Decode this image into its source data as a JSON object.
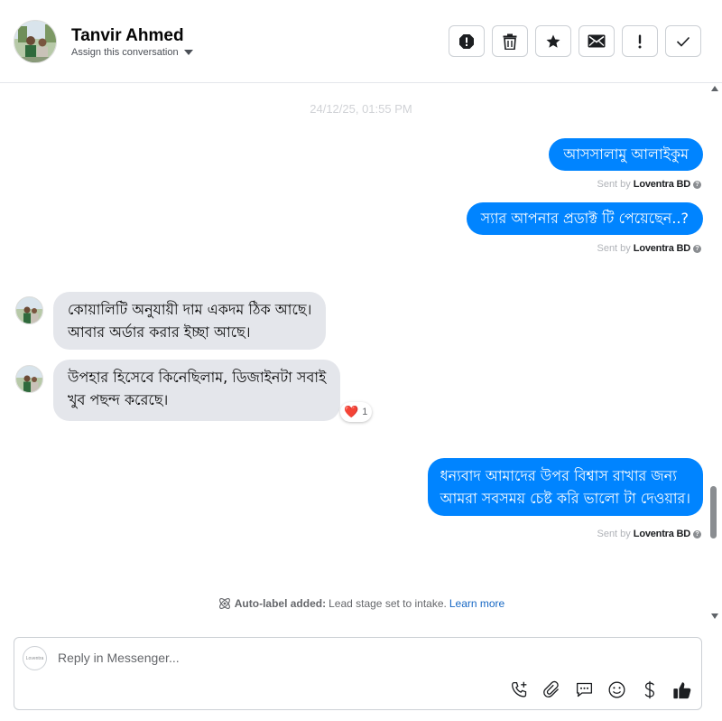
{
  "header": {
    "contact_name": "Tanvir Ahmed",
    "assign_label": "Assign this conversation",
    "actions": [
      "spam-icon",
      "trash-icon",
      "star-icon",
      "mail-icon",
      "exclamation-icon",
      "check-icon"
    ]
  },
  "conversation": {
    "timestamp": "24/12/25, 01:55 PM",
    "messages": [
      {
        "direction": "out",
        "text": "আসসালামু আলাইকুম",
        "sent_by_prefix": "Sent by",
        "sent_by_name": "Loventra BD"
      },
      {
        "direction": "out",
        "text": "স্যার আপনার প্রডাক্ট টি পেয়েছেন..?",
        "sent_by_prefix": "Sent by",
        "sent_by_name": "Loventra BD"
      },
      {
        "direction": "in",
        "lines": [
          "কোয়ালিটি অনুযায়ী দাম একদম ঠিক আছে।",
          "আবার অর্ডার করার ইচ্ছা আছে।"
        ]
      },
      {
        "direction": "in",
        "lines": [
          "উপহার হিসেবে কিনেছিলাম, ডিজাইনটা সবাই",
          "খুব পছন্দ করেছে।"
        ],
        "reaction": {
          "emoji": "❤️",
          "count": "1"
        }
      },
      {
        "direction": "out",
        "lines": [
          "ধন্যবাদ আমাদের উপর বিশ্বাস রাখার জন্য",
          "আমরা সবসময় চেষ্ট করি ভালো টা দেওয়ার।"
        ],
        "sent_by_prefix": "Sent by",
        "sent_by_name": "Loventra BD"
      }
    ],
    "auto_label": {
      "bold": "Auto-label added:",
      "text": "Lead stage set to intake.",
      "link": "Learn more"
    }
  },
  "composer": {
    "placeholder": "Reply in Messenger...",
    "page_avatar_text": "Loventra",
    "tools": [
      "call-add-icon",
      "paperclip-icon",
      "saved-reply-icon",
      "emoji-icon",
      "dollar-icon",
      "thumbs-up-icon"
    ]
  },
  "colors": {
    "outgoing_bubble": "#0084ff",
    "incoming_bubble": "#e4e6eb",
    "link": "#1768c4"
  }
}
